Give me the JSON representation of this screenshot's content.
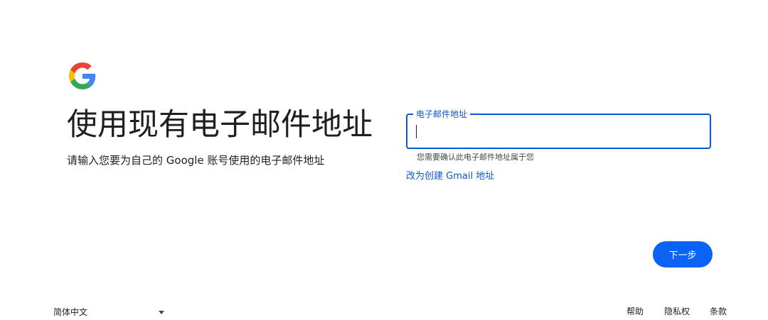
{
  "logo": {
    "icon": "google-g-icon",
    "colors": [
      "#4285F4",
      "#EA4335",
      "#FBBC05",
      "#34A853"
    ]
  },
  "title": "使用现有电子邮件地址",
  "subtitle": "请输入您要为自己的 Google 账号使用的电子邮件地址",
  "email_field": {
    "label": "电子邮件地址",
    "value": "",
    "helper": "您需要确认此电子邮件地址属于您"
  },
  "gmail_link": "改为创建 Gmail 地址",
  "next_button": "下一步",
  "footer": {
    "language": "简体中文",
    "dropdown_icon": "chevron-down-icon",
    "links": {
      "help": "帮助",
      "privacy": "隐私权",
      "terms": "条款"
    }
  },
  "colors": {
    "accent": "#0b57d0",
    "button": "#0b63f6",
    "text": "#1f1f1f"
  }
}
